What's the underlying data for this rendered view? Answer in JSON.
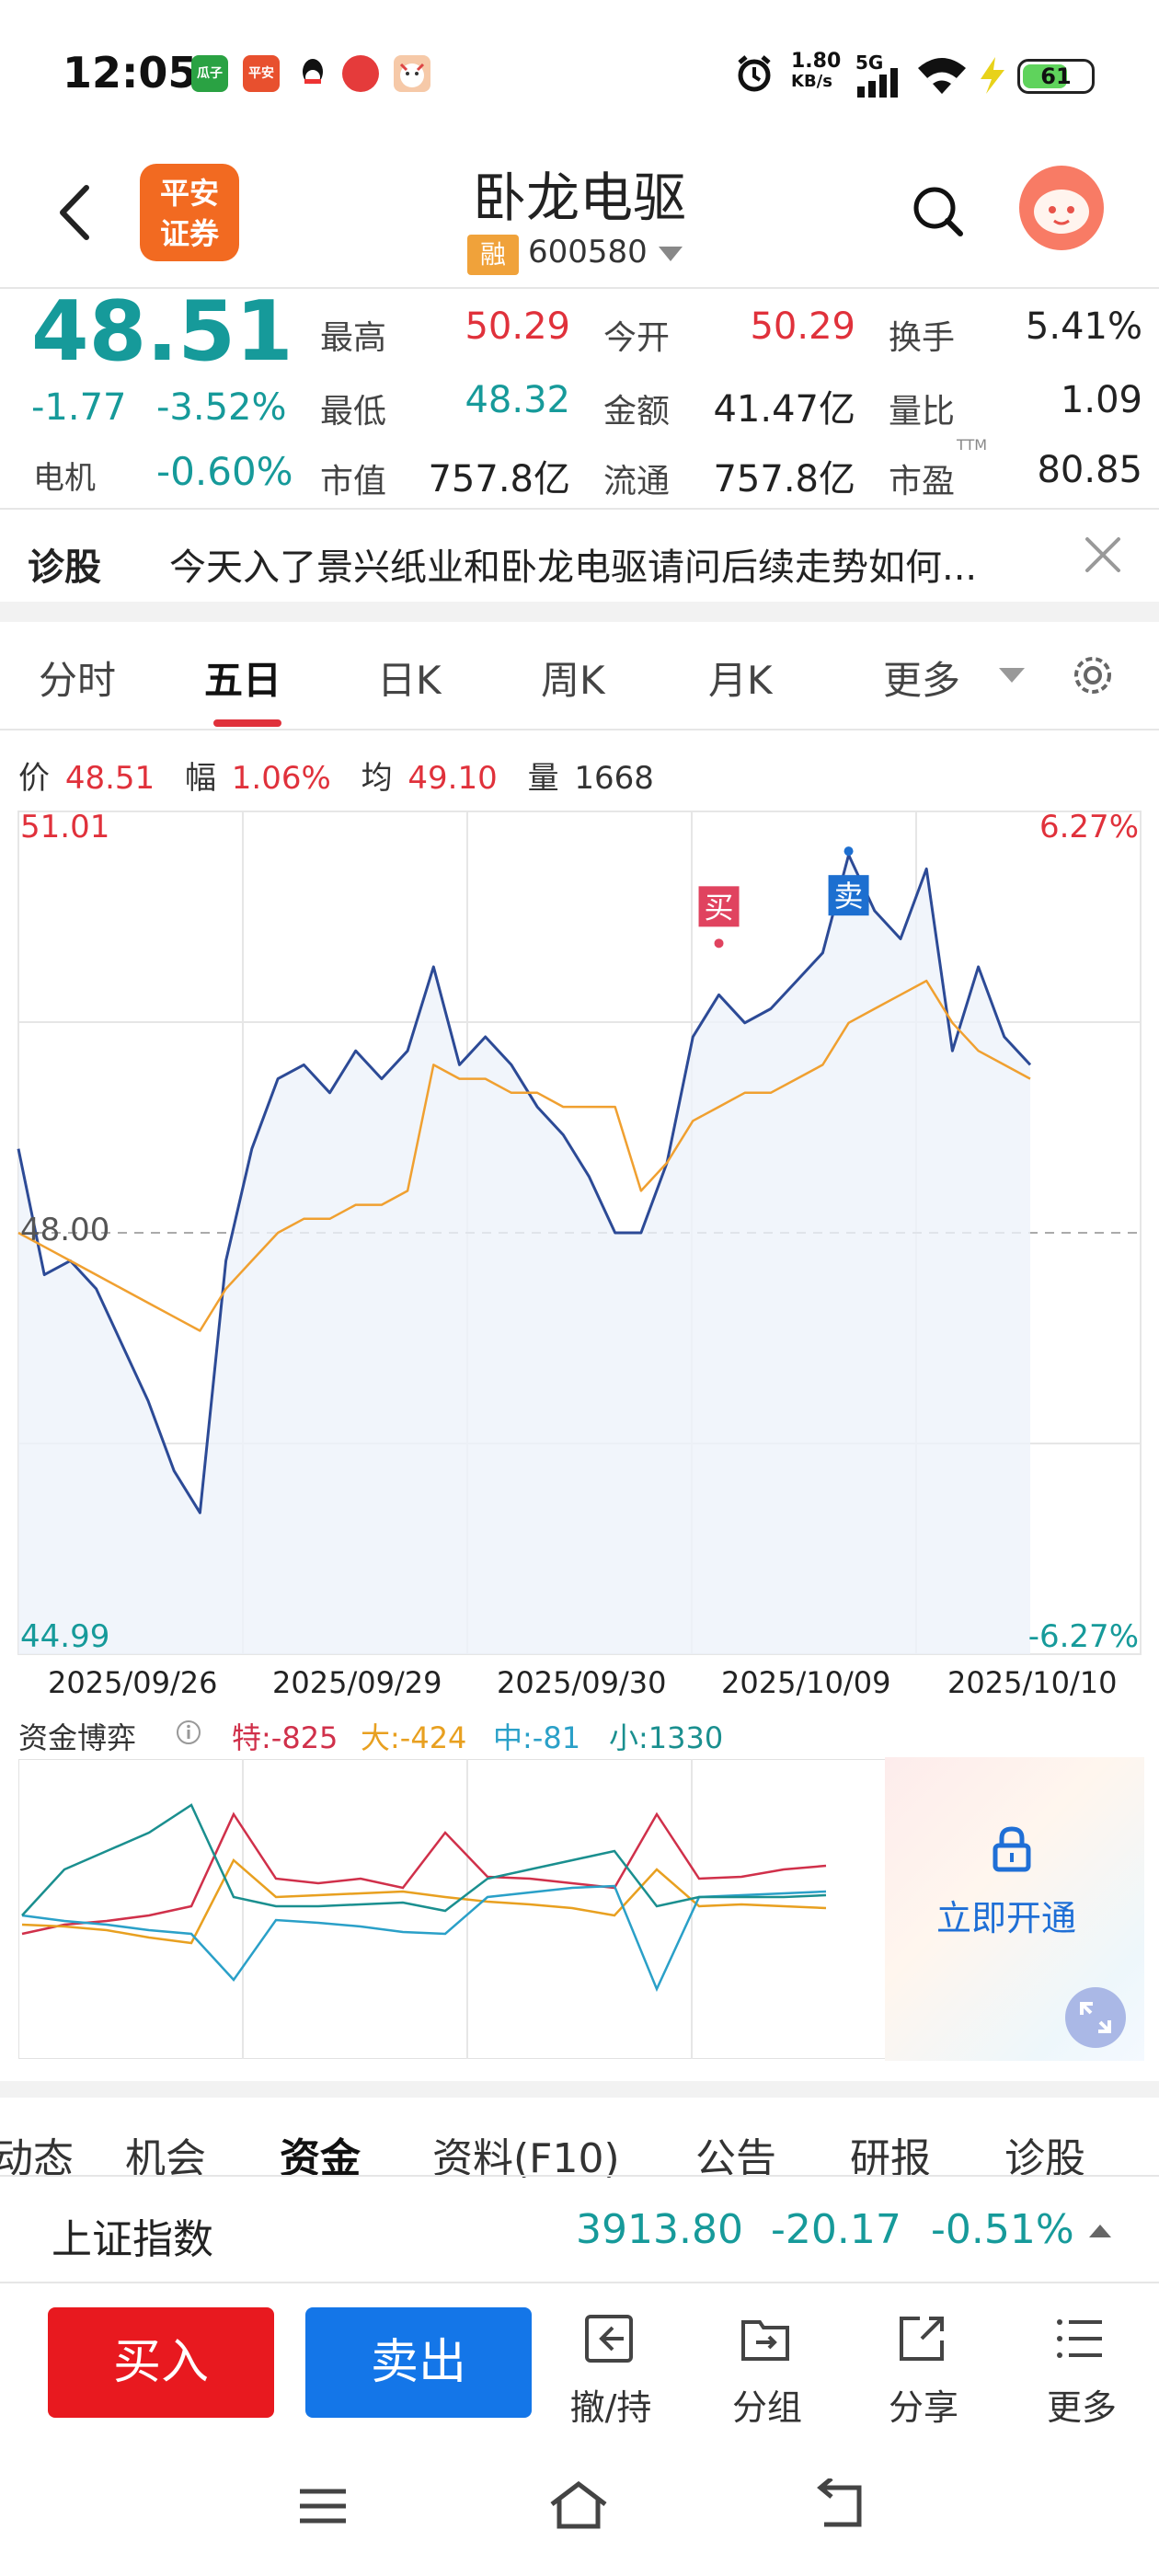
{
  "status_bar": {
    "time": "12:05",
    "app_icons": [
      {
        "name": "guazi-app-icon",
        "label": "瓜子",
        "color": "#2aa243"
      },
      {
        "name": "pingan-bank-app-icon",
        "label": "平安",
        "color": "#e8502e"
      },
      {
        "name": "qq-app-icon",
        "label": "",
        "color": "#111111"
      },
      {
        "name": "social-app-icon",
        "label": "",
        "color": "#e53b3b"
      },
      {
        "name": "game-app-icon",
        "label": "",
        "color": "#f29a5a"
      }
    ],
    "net_speed": "1.80",
    "net_unit": "KB/s",
    "network": "5G",
    "battery": "61"
  },
  "header": {
    "broker_logo": [
      "平安",
      "证券"
    ],
    "stock_name": "卧龙电驱",
    "rong_badge": "融",
    "stock_code": "600580"
  },
  "quote": {
    "price": "48.51",
    "change": "-1.77",
    "change_pct": "-3.52%",
    "sector_name": "电机",
    "sector_chg": "-0.60%",
    "fields": [
      {
        "label": "最高",
        "value": "50.29",
        "tone": "red"
      },
      {
        "label": "今开",
        "value": "50.29",
        "tone": "red"
      },
      {
        "label": "换手",
        "value": "5.41%",
        "tone": "dark"
      },
      {
        "label": "最低",
        "value": "48.32",
        "tone": "green"
      },
      {
        "label": "金额",
        "value": "41.47亿",
        "tone": "dark"
      },
      {
        "label": "量比",
        "value": "1.09",
        "tone": "dark"
      },
      {
        "label": "市值",
        "value": "757.8亿",
        "tone": "dark"
      },
      {
        "label": "流通",
        "value": "757.8亿",
        "tone": "dark"
      },
      {
        "label": "市盈",
        "value": "80.85",
        "tone": "dark"
      }
    ],
    "pe_ttm_tag": "TTM"
  },
  "diagnosis": {
    "label": "诊股",
    "text": "今天入了景兴纸业和卧龙电驱请问后续走势如何..."
  },
  "chart_tabs": [
    "分时",
    "五日",
    "日K",
    "周K",
    "月K",
    "更多"
  ],
  "chart_tabs_active": "五日",
  "info_row": {
    "price_label": "价",
    "price": "48.51",
    "range_label": "幅",
    "range": "1.06%",
    "avg_label": "均",
    "avg": "49.10",
    "vol_label": "量",
    "vol": "1668"
  },
  "chart_data": {
    "type": "line",
    "y_top_label": "51.01",
    "y_bottom_label": "44.99",
    "y_ref_label": "48.00",
    "pct_top_label": "6.27%",
    "pct_bottom_label": "-6.27%",
    "dates": [
      "2025/09/26",
      "2025/09/29",
      "2025/09/30",
      "2025/10/09",
      "2025/10/10"
    ],
    "ylim": [
      44.99,
      51.01
    ],
    "ref_line": 48.0,
    "series": [
      {
        "color": "#2c4a96",
        "values": [
          48.6,
          47.7,
          47.8,
          47.6,
          47.2,
          46.8,
          46.3,
          46.0,
          47.8,
          48.6,
          49.1,
          49.2,
          49.0,
          49.3,
          49.1,
          49.3,
          49.9,
          49.2,
          49.4,
          49.2,
          48.9,
          48.7,
          48.4,
          48.0,
          48.0,
          48.5,
          49.4,
          49.7,
          49.5,
          49.6,
          49.8,
          50.0,
          50.7,
          50.3,
          50.1,
          50.6,
          49.3,
          49.9,
          49.4,
          49.2
        ]
      },
      {
        "color": "#f0a030",
        "values": [
          48.0,
          47.9,
          47.8,
          47.7,
          47.6,
          47.5,
          47.4,
          47.3,
          47.6,
          47.8,
          48.0,
          48.1,
          48.1,
          48.2,
          48.2,
          48.3,
          49.2,
          49.1,
          49.1,
          49.0,
          49.0,
          48.9,
          48.9,
          48.9,
          48.3,
          48.5,
          48.8,
          48.9,
          49.0,
          49.0,
          49.1,
          49.2,
          49.5,
          49.6,
          49.7,
          49.8,
          49.5,
          49.3,
          49.2,
          49.1
        ]
      }
    ],
    "markers": [
      {
        "label": "买",
        "color": "#e0435f"
      },
      {
        "label": "卖",
        "color": "#1d6fd0"
      }
    ]
  },
  "capital_flow": {
    "title": "资金博弈",
    "items": [
      {
        "label": "特:-825",
        "color": "#d0304a"
      },
      {
        "label": "大:-424",
        "color": "#e8a020"
      },
      {
        "label": "中:-81",
        "color": "#2aa0c8"
      },
      {
        "label": "小:1330",
        "color": "#1a8f8f"
      }
    ],
    "lock_text": "立即开通"
  },
  "bottom_tabs": [
    "动态",
    "机会",
    "资金",
    "资料(F10)",
    "公告",
    "研报",
    "诊股"
  ],
  "bottom_tabs_active": "资金",
  "index_bar": {
    "name": "上证指数",
    "value": "3913.80",
    "change": "-20.17",
    "change_pct": "-0.51%"
  },
  "actions": {
    "buy": "买入",
    "sell": "卖出",
    "items": [
      {
        "name": "cancel-hold-icon",
        "label": "撤/持"
      },
      {
        "name": "group-icon",
        "label": "分组"
      },
      {
        "name": "share-icon",
        "label": "分享"
      },
      {
        "name": "more-menu-icon",
        "label": "更多"
      }
    ]
  }
}
